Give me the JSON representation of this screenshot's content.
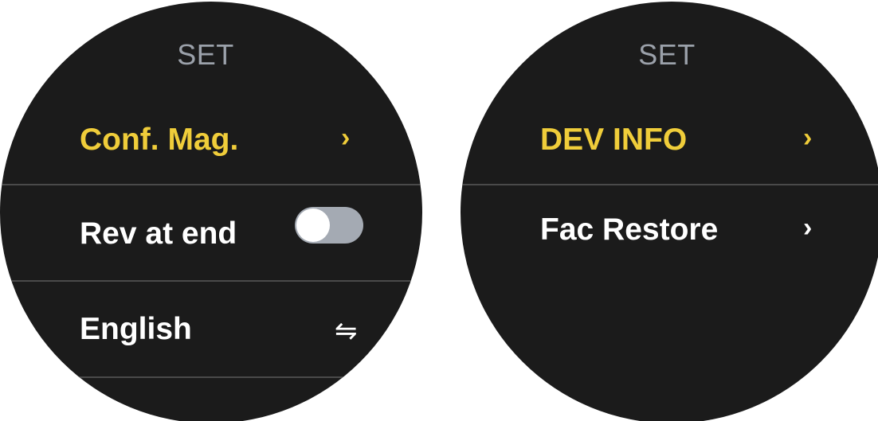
{
  "colors": {
    "screen_bg": "#1b1b1b",
    "accent": "#f0cd3a",
    "title": "#9ba1aa",
    "text": "#ffffff",
    "divider": "#4a4a4a",
    "toggle_off_track": "#a4aab3"
  },
  "screens": [
    {
      "title": "SET",
      "items": [
        {
          "label": "Conf. Mag.",
          "control": "chevron",
          "icon": "chevron-right-icon",
          "glyph": "›",
          "highlighted": true
        },
        {
          "label": "Rev at end",
          "control": "toggle",
          "toggle_on": false,
          "highlighted": false
        },
        {
          "label": "English",
          "control": "swap",
          "icon": "swap-arrows-icon",
          "glyph": "⇋",
          "highlighted": false
        }
      ]
    },
    {
      "title": "SET",
      "items": [
        {
          "label": "DEV INFO",
          "control": "chevron",
          "icon": "chevron-right-icon",
          "glyph": "›",
          "highlighted": true
        },
        {
          "label": "Fac Restore",
          "control": "chevron",
          "icon": "chevron-right-icon",
          "glyph": "›",
          "highlighted": false
        }
      ]
    }
  ]
}
